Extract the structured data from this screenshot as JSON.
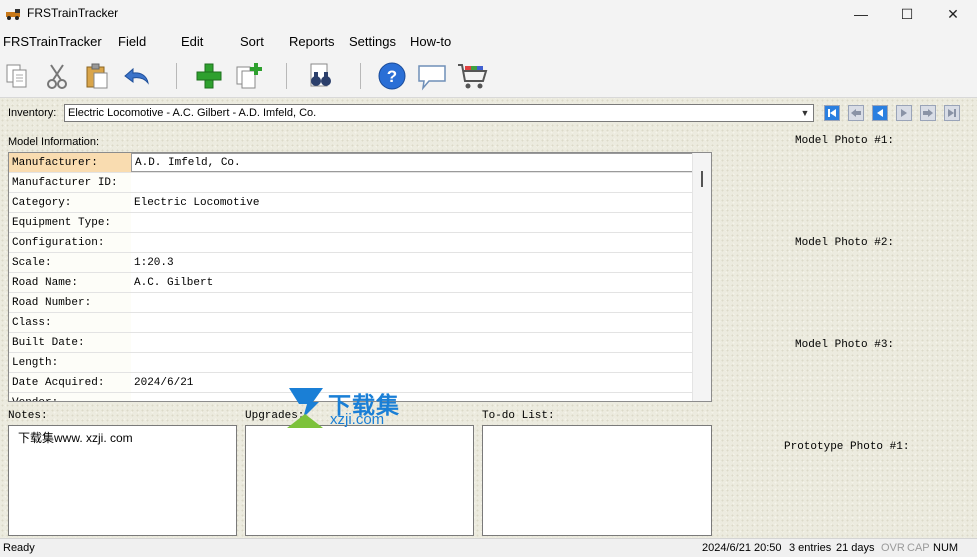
{
  "window": {
    "title": "FRSTrainTracker",
    "minimize_glyph": "—",
    "maximize_glyph": "☐",
    "close_glyph": "✕"
  },
  "menu": [
    "FRSTrainTracker",
    "Field",
    "Edit",
    "Sort",
    "Reports",
    "Settings",
    "How-to"
  ],
  "toolbar_icons": [
    "copy-icon",
    "cut-icon",
    "paste-icon",
    "undo-icon",
    "add-record-icon",
    "add-copy-icon",
    "search-binoculars-icon",
    "help-icon",
    "comment-icon",
    "shopping-cart-icon"
  ],
  "inventory": {
    "label": "Inventory:",
    "selected": "Electric Locomotive - A.C. Gilbert - A.D. Imfeld, Co.",
    "nav_icons": [
      "first-record-icon",
      "previous-page-icon",
      "previous-record-icon",
      "next-record-icon",
      "next-page-icon",
      "last-record-icon"
    ]
  },
  "model_info": {
    "label": "Model Information:",
    "fields": [
      {
        "key": "Manufacturer:",
        "value": "A.D. Imfeld, Co."
      },
      {
        "key": "Manufacturer ID:",
        "value": ""
      },
      {
        "key": "Category:",
        "value": "Electric Locomotive"
      },
      {
        "key": "Equipment Type:",
        "value": ""
      },
      {
        "key": "Configuration:",
        "value": ""
      },
      {
        "key": "Scale:",
        "value": "1:20.3"
      },
      {
        "key": "Road Name:",
        "value": "A.C. Gilbert"
      },
      {
        "key": "Road Number:",
        "value": ""
      },
      {
        "key": "Class:",
        "value": ""
      },
      {
        "key": "Built Date:",
        "value": ""
      },
      {
        "key": "Length:",
        "value": ""
      },
      {
        "key": "Date Acquired:",
        "value": "2024/6/21"
      },
      {
        "key": "Vendor:",
        "value": ""
      }
    ]
  },
  "photos": {
    "model1": "Model Photo #1:",
    "model2": "Model Photo #2:",
    "model3": "Model Photo #3:",
    "prototype1": "Prototype Photo #1:"
  },
  "notes": {
    "label": "Notes:",
    "value": "下载集www. xzji. com"
  },
  "upgrades": {
    "label": "Upgrades:"
  },
  "todo": {
    "label": "To-do List:"
  },
  "watermark": {
    "line1": "下载集",
    "line2": "xzji.com"
  },
  "status": {
    "left": "Ready",
    "datetime": "2024/6/21 20:50",
    "entries": "3 entries",
    "days": "21 days",
    "ovr": "OVR",
    "cap": "CAP",
    "num": "NUM"
  },
  "colors": {
    "selected_field": "#f9dcb0",
    "nav_button": "#2a7fe0",
    "add_green": "#2ea02e",
    "help_blue": "#2a6fd6"
  }
}
